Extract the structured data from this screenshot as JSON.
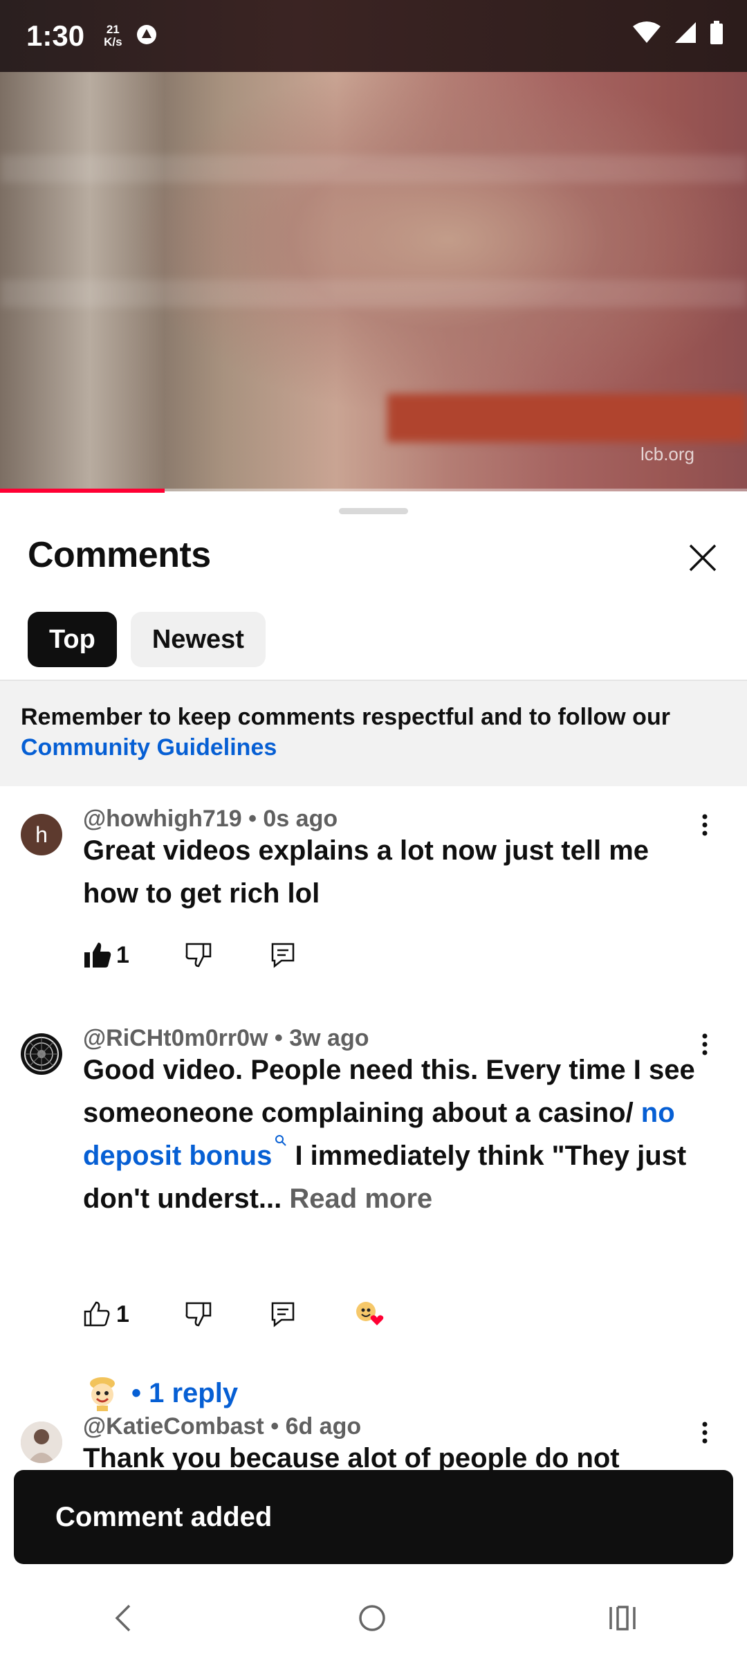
{
  "status_bar": {
    "time": "1:30",
    "net_speed_value": "21",
    "net_speed_unit": "K/s"
  },
  "video": {
    "watermark": "lcb.org",
    "progress": 0.22
  },
  "sheet": {
    "title": "Comments",
    "tabs": [
      {
        "label": "Top",
        "active": true
      },
      {
        "label": "Newest",
        "active": false
      }
    ],
    "notice": {
      "text": "Remember to keep comments respectful and to follow our ",
      "link": "Community Guidelines"
    }
  },
  "comments": [
    {
      "author": "@howhigh719",
      "time": "0s ago",
      "avatar_letter": "h",
      "text": "Great videos explains a lot now just tell me how to get rich lol",
      "likes": "1",
      "liked": true
    },
    {
      "author": "@RiCHt0m0rr0w",
      "time": "3w ago",
      "text_before": "Good video. People need this. Every time I see someoneone complaining about a casino/ ",
      "text_link": "no deposit bonus",
      "text_after": " I immediately think \"They just don't underst... ",
      "read_more": "Read more",
      "likes": "1",
      "liked": false,
      "reply_label": "1 reply"
    },
    {
      "author": "@KatieCombast",
      "time": "6d ago",
      "text": "Thank you because alot of people do not"
    }
  ],
  "toast": "Comment added",
  "colors": {
    "accent_blue": "#065fd4",
    "youtube_red": "#ff0033",
    "text_dark": "#0f0f0f",
    "text_secondary": "#606060"
  }
}
